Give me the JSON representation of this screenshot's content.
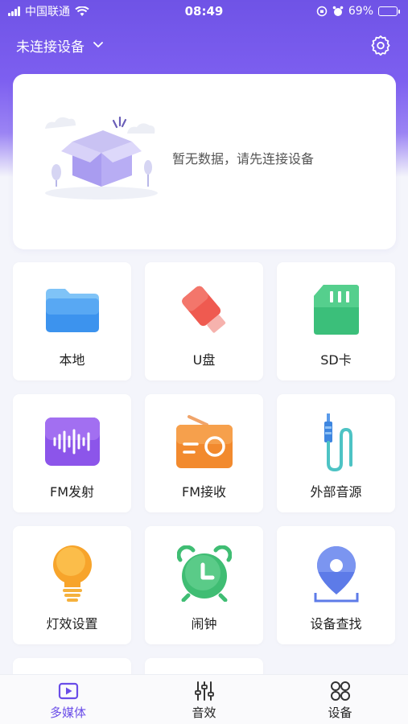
{
  "status_bar": {
    "carrier": "中国联通",
    "time": "08:49",
    "battery": "69%",
    "battery_level": 0.69
  },
  "header": {
    "device_label": "未连接设备"
  },
  "empty_state": {
    "message": "暂无数据，请先连接设备"
  },
  "grid": {
    "items": [
      {
        "label": "本地",
        "icon": "folder-icon"
      },
      {
        "label": "U盘",
        "icon": "usb-drive-icon"
      },
      {
        "label": "SD卡",
        "icon": "sd-card-icon"
      },
      {
        "label": "FM发射",
        "icon": "waveform-icon"
      },
      {
        "label": "FM接收",
        "icon": "radio-icon"
      },
      {
        "label": "外部音源",
        "icon": "aux-cable-icon"
      },
      {
        "label": "灯效设置",
        "icon": "light-bulb-icon"
      },
      {
        "label": "闹钟",
        "icon": "alarm-clock-icon"
      },
      {
        "label": "设备查找",
        "icon": "location-pin-icon"
      }
    ]
  },
  "tabbar": {
    "tabs": [
      {
        "label": "多媒体",
        "icon": "media-play-icon",
        "active": true
      },
      {
        "label": "音效",
        "icon": "equalizer-icon",
        "active": false
      },
      {
        "label": "设备",
        "icon": "grid-icon",
        "active": false
      }
    ]
  },
  "colors": {
    "accent": "#6a4de8",
    "header_gradient_top": "#6f53e6"
  }
}
